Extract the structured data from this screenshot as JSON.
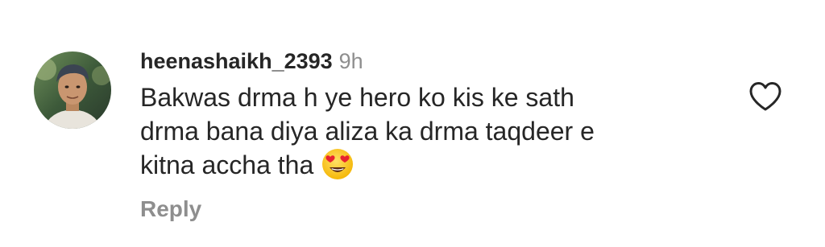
{
  "comment": {
    "username": "heenashaikh_2393",
    "timestamp": "9h",
    "text": "Bakwas drma h ye hero ko kis ke sath\ndrma bana diya aliza ka drma taqdeer e\nkitna accha tha",
    "emoji": "heart-eyes-emoji",
    "reply_label": "Reply",
    "avatar_icon": "user-avatar-photo",
    "like_icon": "heart-outline-icon"
  },
  "colors": {
    "text_primary": "#262626",
    "text_secondary": "#8e8e8e",
    "background": "#ffffff"
  }
}
